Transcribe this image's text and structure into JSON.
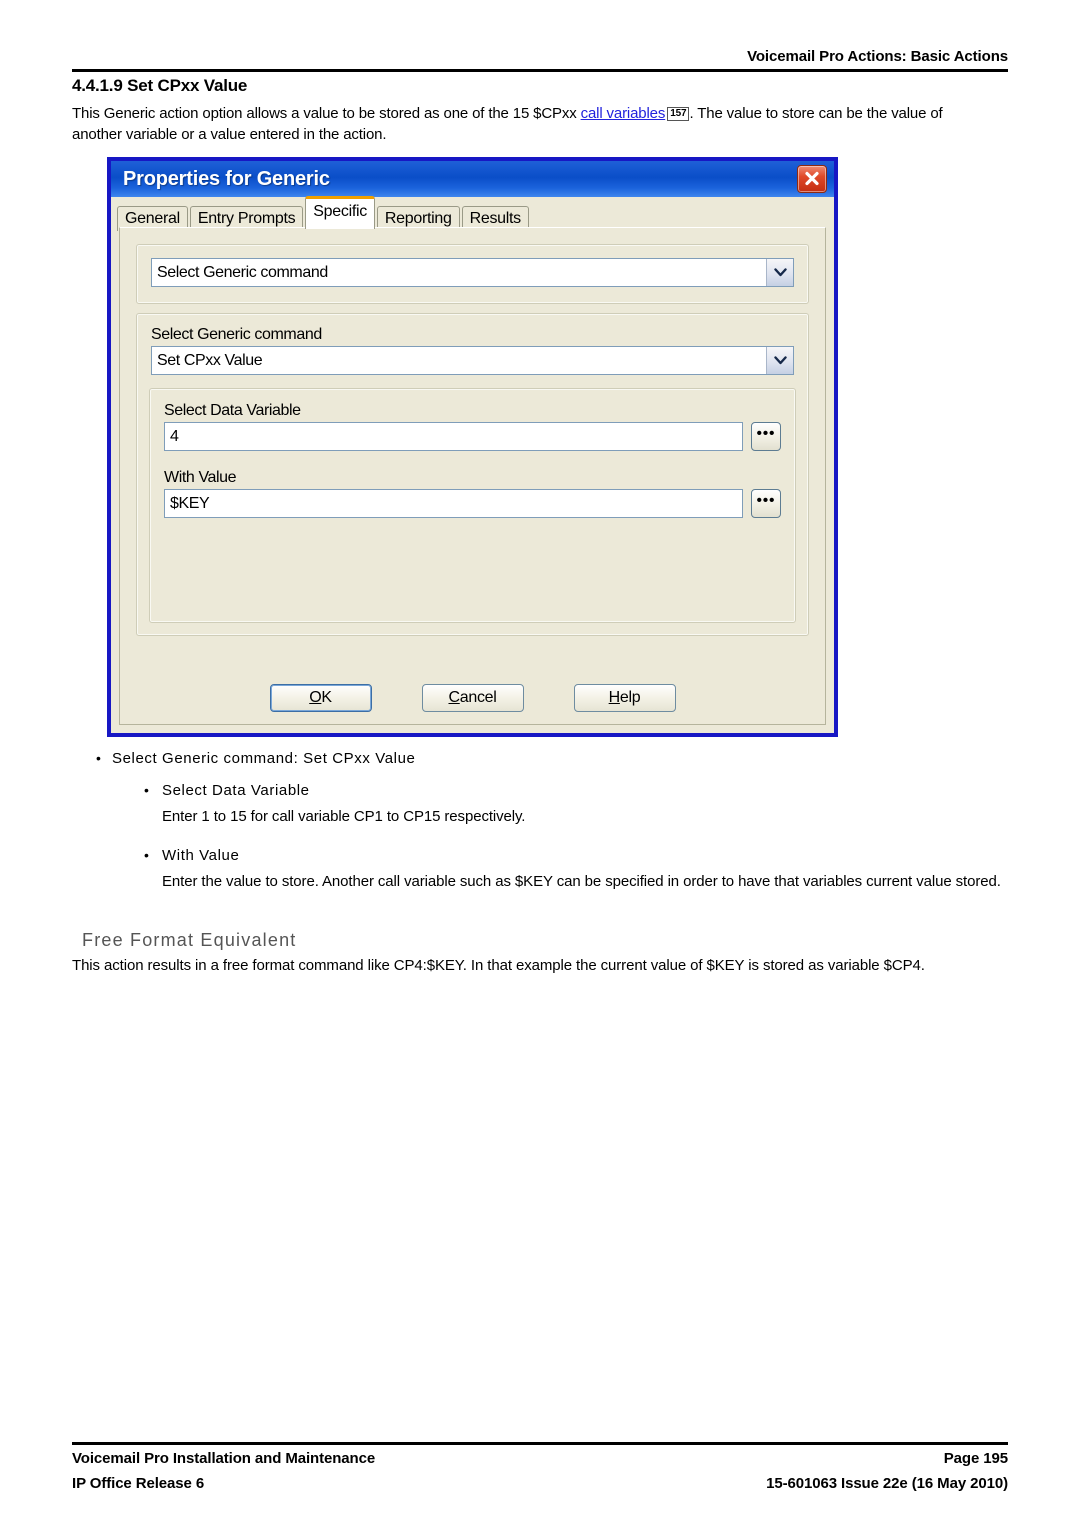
{
  "header": {
    "running_head": "Voicemail Pro Actions: Basic Actions",
    "section_number_title": "4.4.1.9 Set CPxx Value"
  },
  "intro": {
    "part1": "This Generic action option allows a value to be stored as one of the 15 $CPxx ",
    "link_text": "call variables",
    "page_ref": "157",
    "part2": ". The value to store can be the value of another variable or a value entered in the action."
  },
  "dialog": {
    "title": "Properties for Generic",
    "close_icon": "close-icon",
    "tabs": [
      {
        "label": "General",
        "active": false
      },
      {
        "label": "Entry Prompts",
        "active": false
      },
      {
        "label": "Specific",
        "active": true
      },
      {
        "label": "Reporting",
        "active": false
      },
      {
        "label": "Results",
        "active": false
      }
    ],
    "top_combo": {
      "value": "Select Generic command",
      "arrow_icon": "chevron-down-icon"
    },
    "command_group": {
      "label": "Select Generic command",
      "combo_value": "Set CPxx Value",
      "arrow_icon": "chevron-down-icon"
    },
    "data_variable": {
      "label": "Select Data Variable",
      "value": "4",
      "browse_label": "•••"
    },
    "with_value": {
      "label": "With Value",
      "value": "$KEY",
      "browse_label": "•••"
    },
    "buttons": {
      "ok": "OK",
      "ok_accel": "O",
      "ok_rest": "K",
      "cancel_accel": "C",
      "cancel_rest": "ancel",
      "help_accel": "H",
      "help_rest": "elp"
    },
    "colors": {
      "titlebar": "#0a4ec8",
      "window_border": "#1717c4",
      "face": "#ece9d8",
      "active_tab_accent": "#f0a000",
      "close_button": "#c32d12"
    }
  },
  "bullets": {
    "item1": "Select Generic command: Set CPxx Value",
    "sub1_title": "Select Data Variable",
    "sub1_body": "Enter 1 to 15 for call variable CP1 to CP15 respectively.",
    "sub2_title": "With Value",
    "sub2_body": "Enter the value to store. Another call variable such as $KEY can be specified in order to have that variables current value stored."
  },
  "free_format": {
    "heading": "Free Format Equivalent",
    "body": "This action results in a free format command like CP4:$KEY. In that example the current value of $KEY is stored as variable $CP4."
  },
  "footer": {
    "left_line1": "Voicemail Pro Installation and Maintenance",
    "left_line2": "IP Office Release 6",
    "right_line1": "Page 195",
    "right_line2": "15-601063 Issue 22e (16 May 2010)"
  }
}
